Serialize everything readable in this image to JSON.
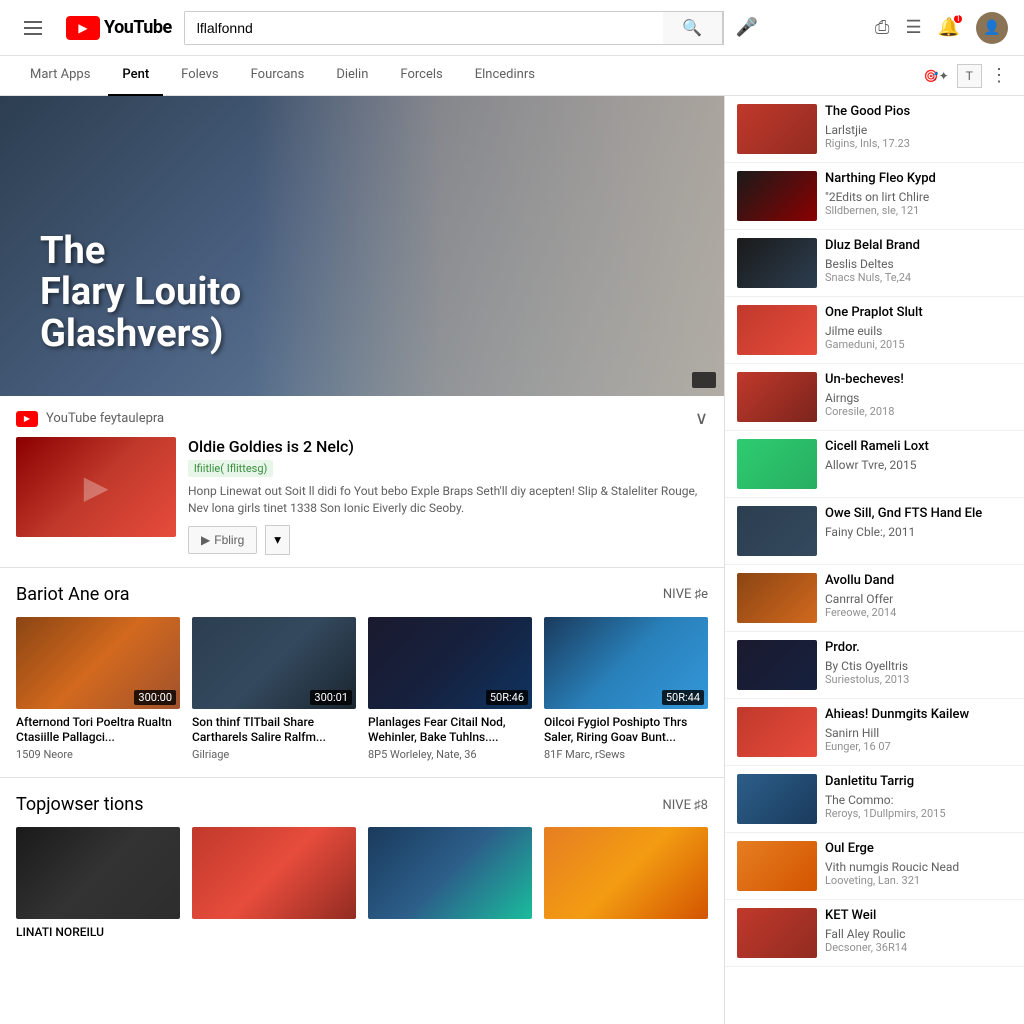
{
  "header": {
    "search_value": "lflalfonnd",
    "search_placeholder": "Search",
    "logo_text": "YouTube"
  },
  "navbar": {
    "items": [
      {
        "label": "Mart Apps",
        "active": false
      },
      {
        "label": "Pent",
        "active": true
      },
      {
        "label": "Folevs",
        "active": false
      },
      {
        "label": "Fourcans",
        "active": false
      },
      {
        "label": "Dielin",
        "active": false
      },
      {
        "label": "Forcels",
        "active": false
      },
      {
        "label": "Elncedinrs",
        "active": false
      }
    ]
  },
  "hero": {
    "title_line1": "The",
    "title_line2": "Flary Louito",
    "title_line3": "Glashvers)"
  },
  "video_info": {
    "channel": "YouTube feytaulepra",
    "title": "Oldie Goldies is 2 Nelc)",
    "badge": "lfiitlie( Iflittesg)",
    "description": "Honp Linewat out Soit ll didi fo Yout bebo Exple Braps Seth'll diy acepten! Slip & Staleliter Rouge, Nev lona girls tinet 1338 Son Ionic Eiverly dic Seoby.",
    "action_label": "Fblirg"
  },
  "section1": {
    "title": "Bariot Ane ora",
    "link": "NIVE ♯e",
    "items": [
      {
        "title": "Afternond Tori Poeltra Rualtn Ctasiille Pallagci...",
        "meta": "1509 Neore",
        "duration": "300:00",
        "thumb_class": "thumb-1"
      },
      {
        "title": "Son thinf TlTbail Share Cartharels Salire Ralfm...",
        "meta": "Gilriage",
        "duration": "300:01",
        "thumb_class": "thumb-2"
      },
      {
        "title": "Planlages Fear Citail Nod, Wehinler, Bake Tuhlns....",
        "meta": "8P5 Worleley, Nate, 36",
        "duration": "50R:46",
        "thumb_class": "thumb-3"
      },
      {
        "title": "Oilcoi Fygiol Poshipto Thrs Saler, Riring Goav Bunt...",
        "meta": "81F Marc, rSews",
        "duration": "50R:44",
        "thumb_class": "thumb-4"
      }
    ]
  },
  "section2": {
    "title": "Topjowser tions",
    "link": "NIVE ♯8",
    "items": [
      {
        "title": "LINATI NOREILU",
        "meta": "",
        "duration": "",
        "thumb_class": "thumb-5"
      },
      {
        "title": "",
        "meta": "",
        "duration": "",
        "thumb_class": "thumb-6"
      },
      {
        "title": "",
        "meta": "",
        "duration": "",
        "thumb_class": "thumb-7"
      },
      {
        "title": "",
        "meta": "",
        "duration": "",
        "thumb_class": "thumb-8"
      }
    ]
  },
  "sidebar": {
    "items": [
      {
        "title": "The Good Pios",
        "channel": "Larlstjie",
        "meta": "Rigins, Inls, 17.23",
        "thumb_class": "s-thumb-1"
      },
      {
        "title": "Narthing Fleo Kypd",
        "channel": "\"2Edits on lirt Chlire",
        "meta": "Slldbernen, sle, 121",
        "thumb_class": "s-thumb-2"
      },
      {
        "title": "Dluz Belal Brand",
        "channel": "Beslis Deltes",
        "meta": "Snacs Nuls, Te,24",
        "thumb_class": "s-thumb-3"
      },
      {
        "title": "One Praplot Slult",
        "channel": "Jilme euils",
        "meta": "Gameduni, 2015",
        "thumb_class": "s-thumb-4"
      },
      {
        "title": "Un-becheves!",
        "channel": "Airngs",
        "meta": "Coresile, 2018",
        "thumb_class": "s-thumb-5"
      },
      {
        "title": "Cicell Rameli Loxt",
        "channel": "Allowr Tvre, 2015",
        "meta": "",
        "thumb_class": "s-thumb-6"
      },
      {
        "title": "Owe Sill, Gnd FTS Hand Ele",
        "channel": "Fainy Cble:, 2011",
        "meta": "",
        "thumb_class": "s-thumb-7"
      },
      {
        "title": "Avollu Dand",
        "channel": "Canrral Offer",
        "meta": "Fereowe, 2014",
        "thumb_class": "s-thumb-8"
      },
      {
        "title": "Prdor.",
        "channel": "By Ctis Oyelltris",
        "meta": "Suriestolus, 2013",
        "thumb_class": "s-thumb-9"
      },
      {
        "title": "Ahieas! Dunmgits Kailew",
        "channel": "Sanirn Hill",
        "meta": "Eunger, 16 07",
        "thumb_class": "s-thumb-10"
      },
      {
        "title": "Danletitu Tarrig",
        "channel": "The Commo:",
        "meta": "Reroys, 1Dullpmirs, 2015",
        "thumb_class": "s-thumb-11"
      },
      {
        "title": "Oul Erge",
        "channel": "Vith numgis Roucic Nead",
        "meta": "Looveting, Lan. 321",
        "thumb_class": "s-thumb-12"
      },
      {
        "title": "KET Weil",
        "channel": "Fall Aley Roulic",
        "meta": "Decsoner, 36R14",
        "thumb_class": "s-thumb-1"
      }
    ]
  }
}
